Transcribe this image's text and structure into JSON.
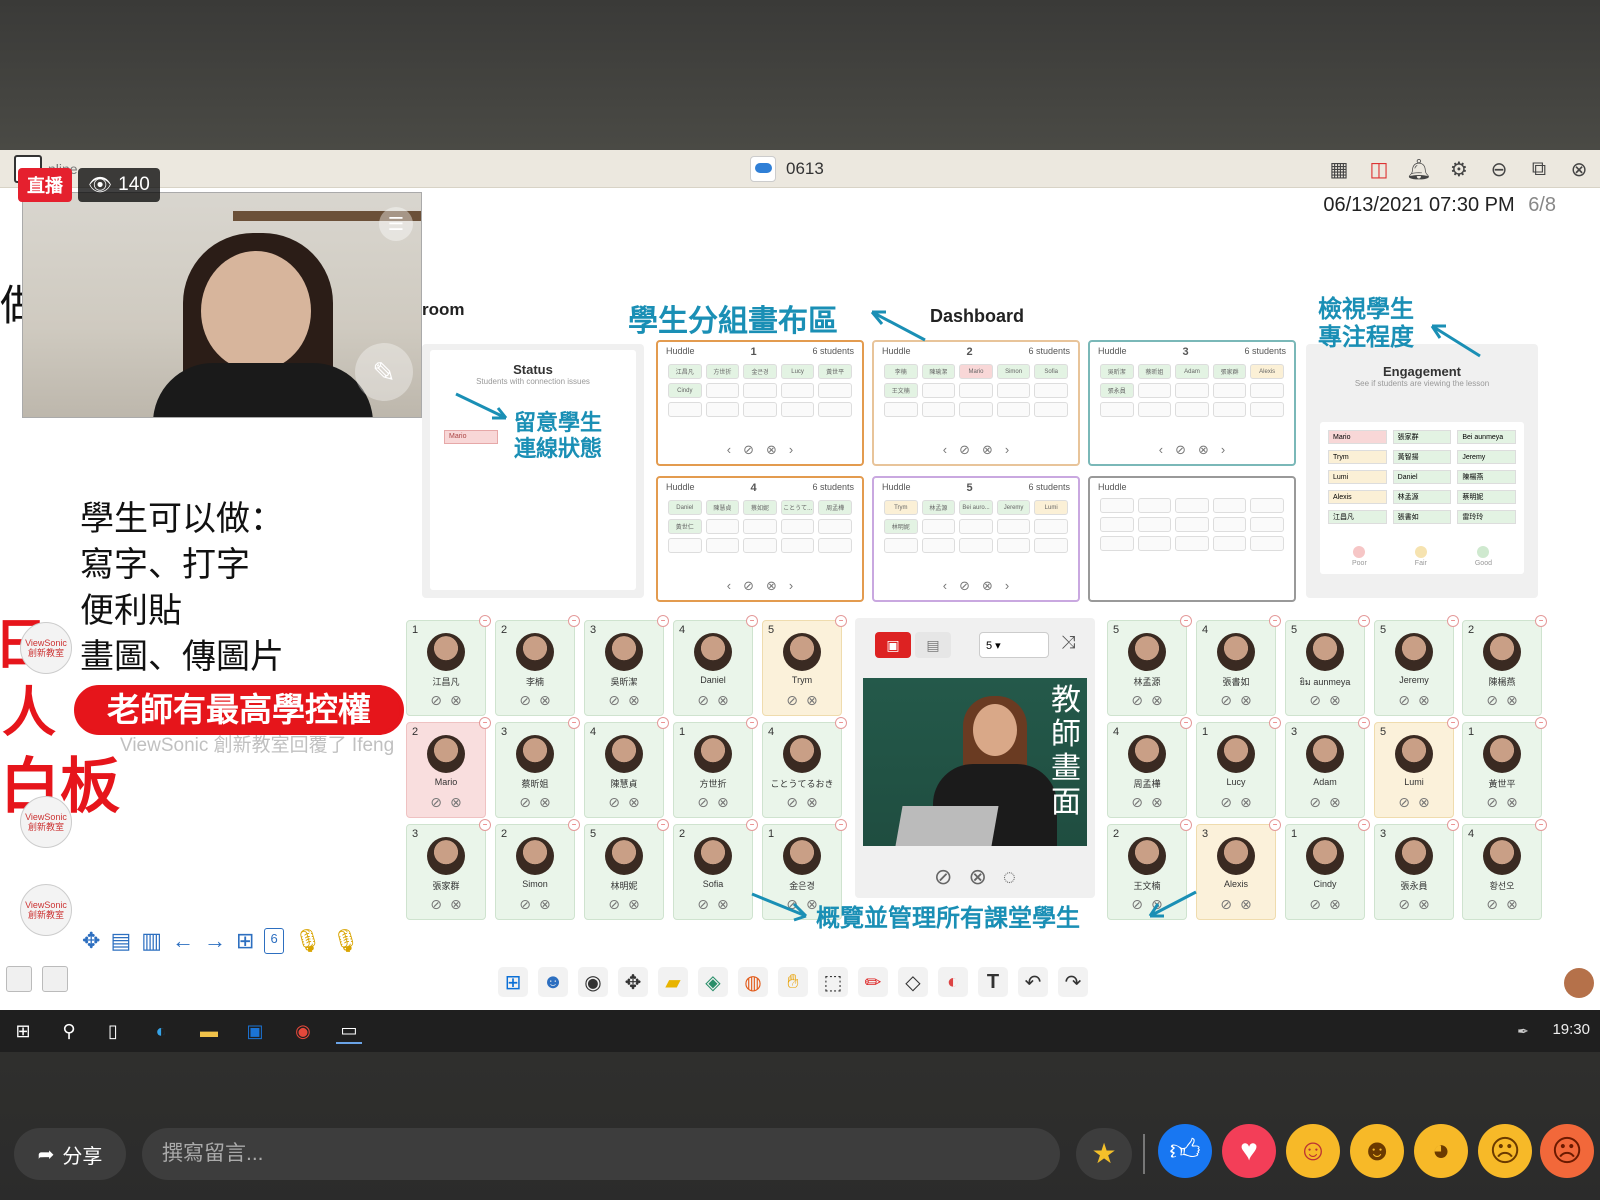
{
  "live": {
    "badge": "直播",
    "viewers": "140"
  },
  "window": {
    "title": "0613",
    "left_title": "nline",
    "date": "06/13/2021",
    "time": "07:30 PM",
    "page": "6/8"
  },
  "slide": {
    "room_label": "room",
    "side_char": "做",
    "features": [
      "學生可以做：",
      "寫字、打字",
      "便利貼",
      "畫圖、傳圖片"
    ],
    "authority": "老師有最高學控權",
    "chat_ghost": "ViewSonic 創新教室回覆了 Ifeng",
    "handwriting": [
      "日",
      "人",
      "白板"
    ]
  },
  "annotations": {
    "groups": "學生分組畫布區",
    "engagement": "檢視學生\n專注程度",
    "status": "留意學生\n連線狀態",
    "overview": "概覽並管理所有課堂學生",
    "dashboard": "Dashboard"
  },
  "status_panel": {
    "title": "Status",
    "subtitle": "Students with connection issues",
    "item": "Mario"
  },
  "engagement_panel": {
    "title": "Engagement",
    "subtitle": "See if students are viewing the lesson",
    "names": [
      "Mario",
      "張家群",
      "Bei aunmeya",
      "Trym",
      "黃智揚",
      "Jeremy",
      "Lumi",
      "Daniel",
      "陳楊燕",
      "Alexis",
      "林孟源",
      "蔡明妮",
      "江昌凡",
      "張書如",
      "雷玲玲"
    ],
    "legend": [
      "Poor",
      "Fair",
      "Good"
    ]
  },
  "huddles": [
    {
      "label": "Huddle",
      "num": "1",
      "count": "6 students",
      "names": [
        "江昌凡",
        "方世折",
        "金은경",
        "Lucy",
        "黃世平",
        "Cindy"
      ]
    },
    {
      "label": "Huddle",
      "num": "2",
      "count": "6 students",
      "names": [
        "李楠",
        "陳瑜潔",
        "Mario",
        "Simon",
        "Sofia",
        "王文楠"
      ]
    },
    {
      "label": "Huddle",
      "num": "3",
      "count": "6 students",
      "names": [
        "吳昕潔",
        "蔡昕姐",
        "Adam",
        "張家群",
        "Alexis",
        "張永員"
      ]
    },
    {
      "label": "Huddle",
      "num": "4",
      "count": "6 students",
      "names": [
        "Daniel",
        "陳慧貞",
        "蔡如妮",
        "ことうて...",
        "周孟樺",
        "黃世仁"
      ]
    },
    {
      "label": "Huddle",
      "num": "5",
      "count": "6 students",
      "names": [
        "Trym",
        "林孟源",
        "Bei auro...",
        "Jeremy",
        "Lumi",
        "林明妮"
      ]
    },
    {
      "label": "Huddle",
      "num": "",
      "count": "",
      "names": []
    }
  ],
  "students_left": [
    {
      "n": "1",
      "name": "江昌凡"
    },
    {
      "n": "2",
      "name": "李楠"
    },
    {
      "n": "3",
      "name": "吳昕潔"
    },
    {
      "n": "4",
      "name": "Daniel"
    },
    {
      "n": "5",
      "name": "Trym"
    },
    {
      "n": "2",
      "name": "Mario"
    },
    {
      "n": "3",
      "name": "蔡昕姐"
    },
    {
      "n": "4",
      "name": "陳慧貞"
    },
    {
      "n": "1",
      "name": "方世折"
    },
    {
      "n": "4",
      "name": "ことうてるおき"
    },
    {
      "n": "3",
      "name": "張家群"
    },
    {
      "n": "2",
      "name": "Simon"
    },
    {
      "n": "5",
      "name": "林明妮"
    },
    {
      "n": "2",
      "name": "Sofia"
    },
    {
      "n": "1",
      "name": "金은경"
    }
  ],
  "students_right": [
    {
      "n": "5",
      "name": "林孟源"
    },
    {
      "n": "4",
      "name": "張書如"
    },
    {
      "n": "5",
      "name": "ยิม aunmeya"
    },
    {
      "n": "5",
      "name": "Jeremy"
    },
    {
      "n": "2",
      "name": "陳楊燕"
    },
    {
      "n": "4",
      "name": "周孟樺"
    },
    {
      "n": "1",
      "name": "Lucy"
    },
    {
      "n": "3",
      "name": "Adam"
    },
    {
      "n": "5",
      "name": "Lumi"
    },
    {
      "n": "1",
      "name": "黃世平"
    },
    {
      "n": "2",
      "name": "王文楠"
    },
    {
      "n": "3",
      "name": "Alexis"
    },
    {
      "n": "1",
      "name": "Cindy"
    },
    {
      "n": "3",
      "name": "張永員"
    },
    {
      "n": "4",
      "name": "황선오"
    }
  ],
  "teacher": {
    "text": "教師畫面",
    "select_value": "5"
  },
  "slide_page_counter": "6",
  "taskbar": {
    "clock": "19:30"
  },
  "facebook": {
    "share": "分享",
    "comment_placeholder": "撰寫留言..."
  },
  "colors": {
    "live_red": "#e5202e",
    "anno_blue": "#1a8fb5",
    "huddle_orange": "#e39b4f",
    "huddle_purple": "#c9a8e0",
    "huddle_teal": "#7ab8b8"
  }
}
